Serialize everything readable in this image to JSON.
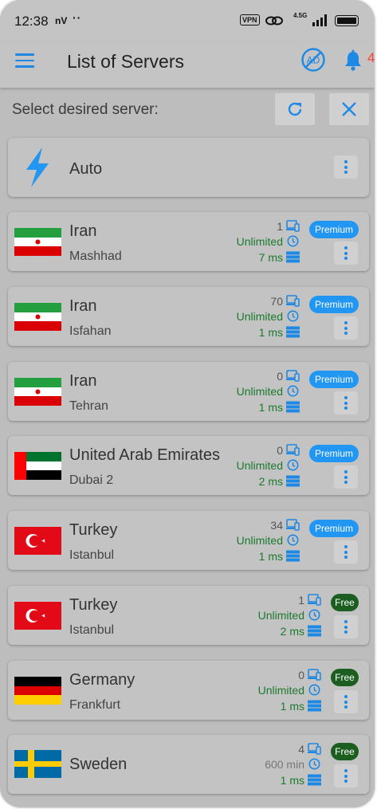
{
  "status_bar": {
    "time": "12:38",
    "carrier": "nV",
    "dots": "··",
    "vpn": "VPN",
    "network": "4.5G"
  },
  "appbar": {
    "title": "List of Servers",
    "notification_count": "4",
    "noad_label": "AD"
  },
  "toolbar": {
    "select_label": "Select desired server:"
  },
  "auto": {
    "label": "Auto"
  },
  "servers": [
    {
      "country": "Iran",
      "city": "Mashhad",
      "users": "1",
      "time": "Unlimited",
      "ping": "7 ms",
      "tag": "Premium",
      "flag": "iran"
    },
    {
      "country": "Iran",
      "city": "Isfahan",
      "users": "70",
      "time": "Unlimited",
      "ping": "1 ms",
      "tag": "Premium",
      "flag": "iran"
    },
    {
      "country": "Iran",
      "city": "Tehran",
      "users": "0",
      "time": "Unlimited",
      "ping": "1 ms",
      "tag": "Premium",
      "flag": "iran"
    },
    {
      "country": "United Arab Emirates",
      "city": "Dubai 2",
      "users": "0",
      "time": "Unlimited",
      "ping": "2 ms",
      "tag": "Premium",
      "flag": "uae"
    },
    {
      "country": "Turkey",
      "city": "Istanbul",
      "users": "34",
      "time": "Unlimited",
      "ping": "1 ms",
      "tag": "Premium",
      "flag": "turkey"
    },
    {
      "country": "Turkey",
      "city": "Istanbul",
      "users": "1",
      "time": "Unlimited",
      "ping": "2 ms",
      "tag": "Free",
      "flag": "turkey"
    },
    {
      "country": "Germany",
      "city": "Frankfurt",
      "users": "0",
      "time": "Unlimited",
      "ping": "1 ms",
      "tag": "Free",
      "flag": "germany"
    },
    {
      "country": "Sweden",
      "city": "",
      "users": "4",
      "time": "600 min",
      "ping": "1 ms",
      "tag": "Free",
      "flag": "sweden"
    }
  ],
  "colors": {
    "accent": "#1e88e5",
    "premium": "#2196f3",
    "free": "#1b5e20",
    "stat_green": "#1b7a2e",
    "badge_red": "#f44336"
  }
}
